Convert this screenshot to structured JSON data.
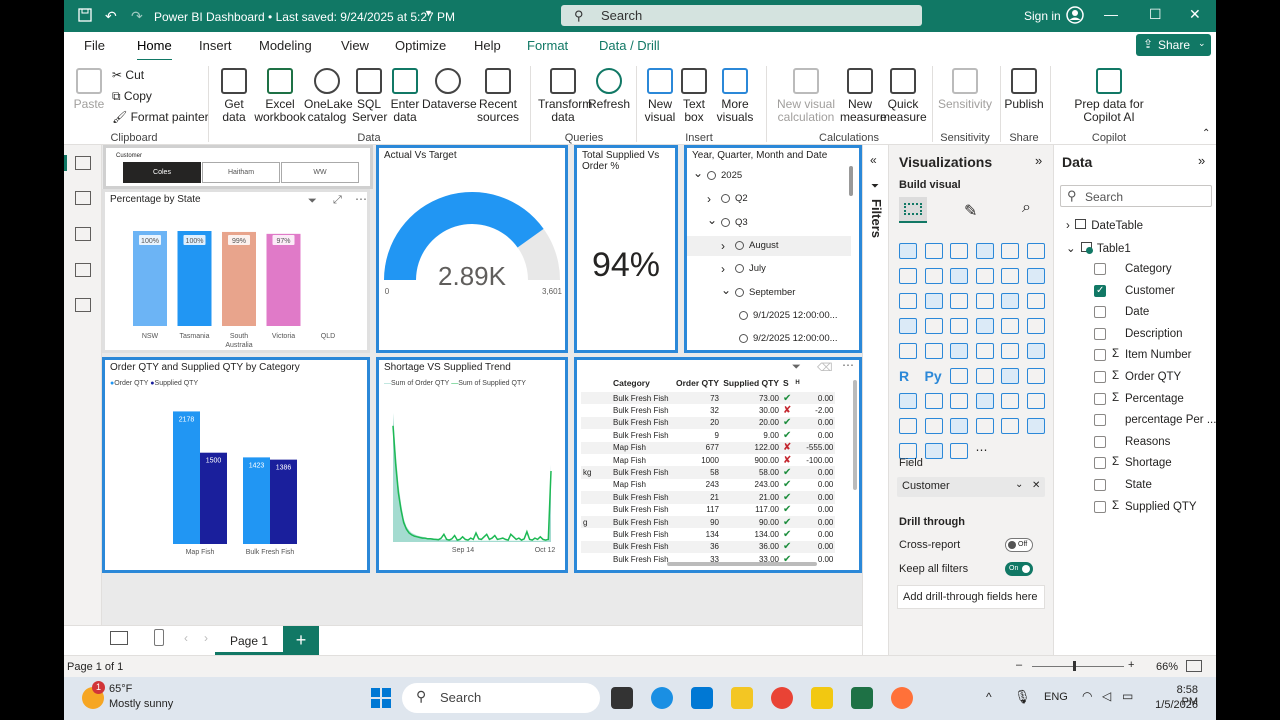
{
  "window": {
    "title": "Power BI Dashboard • Last saved: 9/24/2025 at 5:27 PM",
    "search_placeholder": "Search",
    "sign_in": "Sign in"
  },
  "menu_tabs": [
    "File",
    "Home",
    "Insert",
    "Modeling",
    "View",
    "Optimize",
    "Help",
    "Format",
    "Data / Drill"
  ],
  "share_label": "Share",
  "ribbon": {
    "clipboard": {
      "paste": "Paste",
      "cut": "Cut",
      "copy": "Copy",
      "format_painter": "Format painter",
      "group": "Clipboard"
    },
    "data": {
      "get_data": "Get data",
      "excel": "Excel workbook",
      "onelake": "OneLake catalog",
      "sql": "SQL Server",
      "enter": "Enter data",
      "dataverse": "Dataverse",
      "recent": "Recent sources",
      "group": "Data"
    },
    "queries": {
      "transform": "Transform data",
      "refresh": "Refresh",
      "group": "Queries"
    },
    "insert": {
      "new_visual": "New visual",
      "text_box": "Text box",
      "more_visuals": "More visuals",
      "group": "Insert"
    },
    "calculations": {
      "new_visual_calc": "New visual calculation",
      "new_measure": "New measure",
      "quick_measure": "Quick measure",
      "group": "Calculations"
    },
    "sensitivity": {
      "label": "Sensitivity",
      "group": "Sensitivity"
    },
    "share": {
      "publish": "Publish",
      "group": "Share"
    },
    "copilot": {
      "prep": "Prep data for Copilot AI",
      "group": "Copilot"
    }
  },
  "slicer": {
    "title": "Customer",
    "options": [
      "Coles",
      "Haitham",
      "WW"
    ],
    "selected": "Coles"
  },
  "percentage_by_state": {
    "title": "Percentage by State",
    "chart_data": {
      "type": "bar",
      "categories": [
        "NSW",
        "Tasmania",
        "South Australia",
        "Victoria",
        "QLD"
      ],
      "values": [
        100,
        100,
        99,
        97,
        null
      ],
      "data_labels": [
        "100%",
        "100%",
        "99%",
        "97%",
        ""
      ],
      "colors": [
        "#6cb4f5",
        "#2196f3",
        "#e8a48c",
        "#e07ac8",
        "#cccccc"
      ]
    }
  },
  "gauge": {
    "title": "Actual Vs Target",
    "chart_data": {
      "type": "gauge",
      "value": 2890,
      "value_label": "2.89K",
      "min": 0,
      "min_label": "0",
      "max": 3601,
      "max_label": "3,601",
      "color": "#2196f3"
    }
  },
  "card": {
    "title": "Total Supplied Vs Order %",
    "value": "94%"
  },
  "hierarchy": {
    "title": "Year, Quarter, Month and Date",
    "items": [
      {
        "label": "2025",
        "level": 0,
        "chev": "down"
      },
      {
        "label": "Q2",
        "level": 1,
        "chev": "right"
      },
      {
        "label": "Q3",
        "level": 1,
        "chev": "down"
      },
      {
        "label": "August",
        "level": 2,
        "chev": "right"
      },
      {
        "label": "July",
        "level": 2,
        "chev": "right"
      },
      {
        "label": "September",
        "level": 2,
        "chev": "down"
      },
      {
        "label": "9/1/2025 12:00:00...",
        "level": 3,
        "chev": ""
      },
      {
        "label": "9/2/2025 12:00:00...",
        "level": 3,
        "chev": ""
      }
    ]
  },
  "category_chart": {
    "title": "Order QTY and Supplied QTY by Category",
    "chart_data": {
      "type": "bar",
      "categories": [
        "Map Fish",
        "Bulk Fresh Fish"
      ],
      "series": [
        {
          "name": "Order QTY",
          "values": [
            2178,
            1423
          ],
          "color": "#2196f3"
        },
        {
          "name": "Supplied QTY",
          "values": [
            1500,
            1386
          ],
          "color": "#1a1f9c"
        }
      ]
    }
  },
  "trend_chart": {
    "title": "Shortage VS Supplied Trend",
    "chart_data": {
      "type": "area",
      "x_ticks": [
        "Sep 14",
        "Oct 12"
      ],
      "series": [
        {
          "name": "Sum of Order QTY",
          "color": "#86cfc0",
          "values": [
            1000,
            700,
            450,
            300,
            180,
            120,
            90,
            70,
            60,
            50,
            45,
            40,
            35,
            30,
            30,
            30,
            25,
            25,
            20,
            20,
            20,
            18,
            15,
            15,
            15,
            10,
            10,
            10,
            10,
            10,
            10,
            10,
            10,
            10,
            10,
            10,
            10,
            10,
            10,
            10,
            10,
            10,
            10,
            10,
            10,
            10,
            10,
            10,
            10,
            10,
            10,
            10,
            10,
            10,
            10,
            10,
            10,
            10,
            10,
            600
          ]
        },
        {
          "name": "Sum of Supplied QTY",
          "color": "#1db954",
          "values": [
            900,
            600,
            380,
            250,
            150,
            100,
            70,
            55,
            45,
            40,
            35,
            30,
            30,
            25,
            25,
            22,
            20,
            18,
            30,
            60,
            20,
            15,
            25,
            50,
            15,
            20,
            40,
            20,
            15,
            30,
            20,
            70,
            25,
            20,
            40,
            60,
            20,
            30,
            50,
            20,
            25,
            30,
            20,
            15,
            60,
            40,
            20,
            30,
            15,
            25,
            80,
            20,
            15,
            30,
            20,
            40,
            20,
            15,
            20,
            550
          ]
        }
      ]
    }
  },
  "matrix": {
    "headers": [
      "Category",
      "Order QTY",
      "Supplied QTY",
      "S",
      "H"
    ],
    "rows": [
      {
        "pre": "",
        "cat": "Bulk Fresh Fish",
        "order": "73",
        "supplied": "73.00",
        "ok": true,
        "s": "0.00"
      },
      {
        "pre": "",
        "cat": "Bulk Fresh Fish",
        "order": "32",
        "supplied": "30.00",
        "ok": false,
        "s": "-2.00"
      },
      {
        "pre": "",
        "cat": "Bulk Fresh Fish",
        "order": "20",
        "supplied": "20.00",
        "ok": true,
        "s": "0.00"
      },
      {
        "pre": "",
        "cat": "Bulk Fresh Fish",
        "order": "9",
        "supplied": "9.00",
        "ok": true,
        "s": "0.00"
      },
      {
        "pre": "",
        "cat": "Map Fish",
        "order": "677",
        "supplied": "122.00",
        "ok": false,
        "s": "-555.00"
      },
      {
        "pre": "",
        "cat": "Map Fish",
        "order": "1000",
        "supplied": "900.00",
        "ok": false,
        "s": "-100.00"
      },
      {
        "pre": "kg",
        "cat": "Bulk Fresh Fish",
        "order": "58",
        "supplied": "58.00",
        "ok": true,
        "s": "0.00"
      },
      {
        "pre": "",
        "cat": "Map Fish",
        "order": "243",
        "supplied": "243.00",
        "ok": true,
        "s": "0.00"
      },
      {
        "pre": "",
        "cat": "Bulk Fresh Fish",
        "order": "21",
        "supplied": "21.00",
        "ok": true,
        "s": "0.00"
      },
      {
        "pre": "",
        "cat": "Bulk Fresh Fish",
        "order": "117",
        "supplied": "117.00",
        "ok": true,
        "s": "0.00"
      },
      {
        "pre": "g",
        "cat": "Bulk Fresh Fish",
        "order": "90",
        "supplied": "90.00",
        "ok": true,
        "s": "0.00"
      },
      {
        "pre": "",
        "cat": "Bulk Fresh Fish",
        "order": "134",
        "supplied": "134.00",
        "ok": true,
        "s": "0.00"
      },
      {
        "pre": "",
        "cat": "Bulk Fresh Fish",
        "order": "36",
        "supplied": "36.00",
        "ok": true,
        "s": "0.00"
      },
      {
        "pre": "",
        "cat": "Bulk Fresh Fish",
        "order": "33",
        "supplied": "33.00",
        "ok": true,
        "s": "0.00"
      }
    ]
  },
  "filters_label": "Filters",
  "visualizations": {
    "title": "Visualizations",
    "build_visual": "Build visual",
    "field_label": "Field",
    "field_value": "Customer",
    "drill_through": "Drill through",
    "cross_report": "Cross-report",
    "cross_report_state": "Off",
    "keep_filters": "Keep all filters",
    "keep_filters_state": "On",
    "add_drill": "Add drill-through fields here",
    "r_label": "R",
    "py_label": "Py"
  },
  "data_pane": {
    "title": "Data",
    "search_placeholder": "Search",
    "tables": [
      "DateTable",
      "Table1"
    ],
    "fields": [
      {
        "name": "Category",
        "sigma": false,
        "checked": false
      },
      {
        "name": "Customer",
        "sigma": false,
        "checked": true
      },
      {
        "name": "Date",
        "sigma": false,
        "checked": false
      },
      {
        "name": "Description",
        "sigma": false,
        "checked": false
      },
      {
        "name": "Item Number",
        "sigma": true,
        "checked": false
      },
      {
        "name": "Order QTY",
        "sigma": true,
        "checked": false
      },
      {
        "name": "Percentage",
        "sigma": true,
        "checked": false
      },
      {
        "name": "percentage Per ...",
        "sigma": false,
        "checked": false
      },
      {
        "name": "Reasons",
        "sigma": false,
        "checked": false
      },
      {
        "name": "Shortage",
        "sigma": true,
        "checked": false
      },
      {
        "name": "State",
        "sigma": false,
        "checked": false
      },
      {
        "name": "Supplied QTY",
        "sigma": true,
        "checked": false
      }
    ]
  },
  "pages": {
    "current": "Page 1",
    "add": "+"
  },
  "status": {
    "page": "Page 1 of 1",
    "zoom": "66%",
    "zoom_fraction": 0.45
  },
  "taskbar": {
    "weather_temp": "65°F",
    "weather_desc": "Mostly sunny",
    "weather_badge": "1",
    "search": "Search",
    "lang": "ENG",
    "time": "8:58 PM",
    "date": "1/5/2026"
  }
}
